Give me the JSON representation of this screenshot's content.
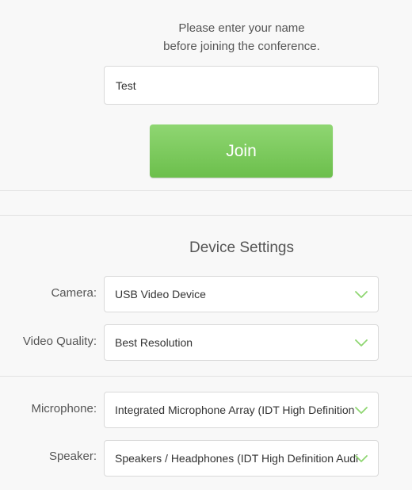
{
  "join": {
    "prompt_line1": "Please enter your name",
    "prompt_line2": "before joining the conference.",
    "name_value": "Test",
    "join_label": "Join"
  },
  "device_settings": {
    "title": "Device Settings",
    "camera": {
      "label": "Camera:",
      "value": "USB Video Device"
    },
    "video_quality": {
      "label": "Video Quality:",
      "value": "Best Resolution"
    },
    "microphone": {
      "label": "Microphone:",
      "value": "Integrated Microphone Array (IDT High Definition"
    },
    "speaker": {
      "label": "Speaker:",
      "value": "Speakers / Headphones (IDT High Definition Audio"
    }
  },
  "icons": {
    "dropdown": "chevron-down-icon"
  },
  "colors": {
    "join_button": "#7acb5b",
    "chevron": "#8fd672",
    "background": "#f8f8f8"
  }
}
